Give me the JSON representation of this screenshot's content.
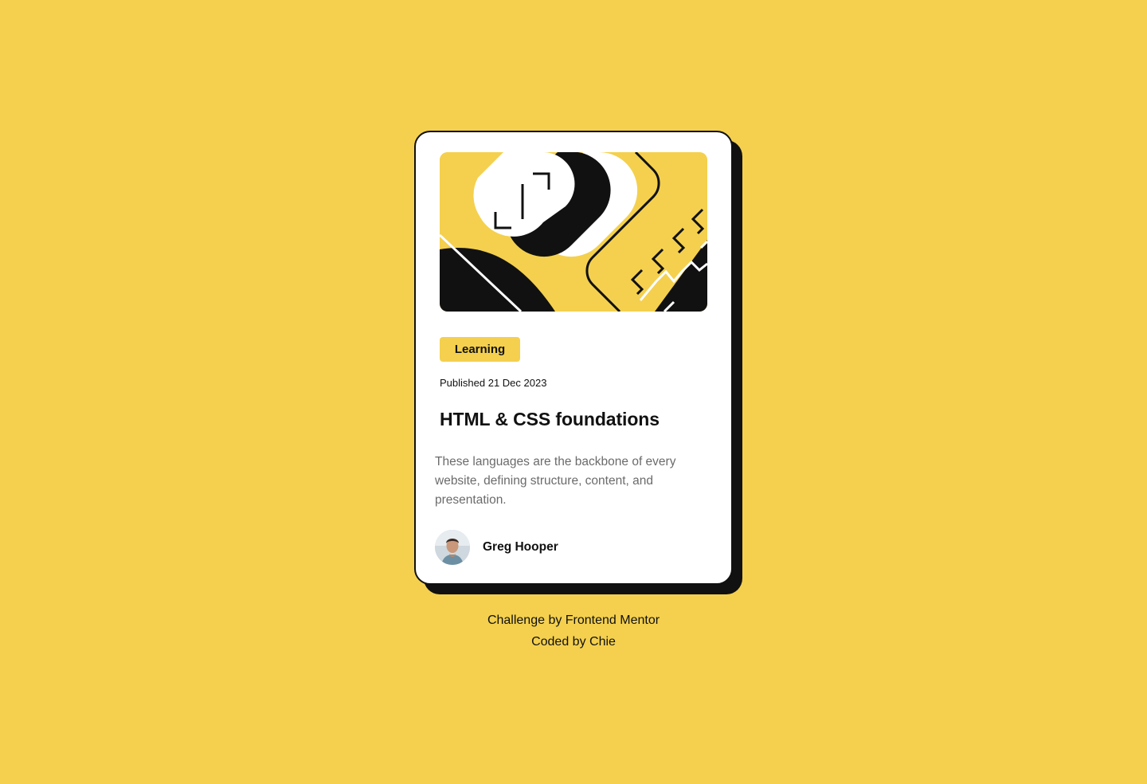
{
  "colors": {
    "background": "#F4D04E",
    "card": "#FFFFFF",
    "ink": "#111111",
    "muted": "#6B6B6B"
  },
  "card": {
    "illustration": "abstract-illustration",
    "tag": "Learning",
    "published": "Published 21 Dec 2023",
    "title": "HTML & CSS foundations",
    "description": "These languages are the backbone of every website, defining structure, content, and presentation.",
    "author": {
      "avatar": "avatar-photo",
      "name": "Greg Hooper"
    }
  },
  "attribution": {
    "line1": "Challenge by Frontend Mentor",
    "line2": "Coded by Chie"
  }
}
